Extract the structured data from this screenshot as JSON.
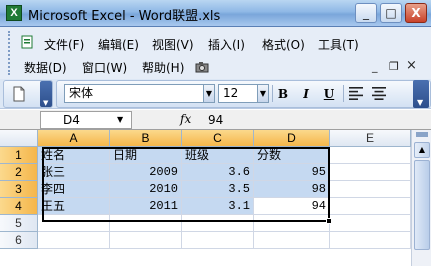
{
  "window": {
    "title": "Microsoft Excel - Word联盟.xls",
    "app_icon": "excel-icon",
    "controls": {
      "minimize": "_",
      "maximize": "□",
      "close": "X"
    }
  },
  "menu": {
    "items": [
      {
        "label": "文件(F)"
      },
      {
        "label": "编辑(E)"
      },
      {
        "label": "视图(V)"
      },
      {
        "label": "插入(I)"
      },
      {
        "label": "格式(O)"
      },
      {
        "label": "工具(T)"
      },
      {
        "label": "数据(D)"
      },
      {
        "label": "窗口(W)"
      },
      {
        "label": "帮助(H)"
      }
    ],
    "doc_controls": {
      "minimize": "_",
      "restore": "❐",
      "close": "×"
    }
  },
  "toolbar": {
    "font_name": "宋体",
    "font_size": "12",
    "bold": "B",
    "italic": "I",
    "underline": "U"
  },
  "formula_bar": {
    "name_box": "D4",
    "fx": "fx",
    "value": "94"
  },
  "sheet": {
    "columns": [
      "A",
      "B",
      "C",
      "D",
      "E"
    ],
    "rows": [
      "1",
      "2",
      "3",
      "4",
      "5",
      "6"
    ],
    "selected_columns": [
      "A",
      "B",
      "C",
      "D"
    ],
    "selected_rows": [
      "1",
      "2",
      "3",
      "4"
    ],
    "active_cell": "D4",
    "cells": [
      [
        "姓名",
        "日期",
        "班级",
        "分数"
      ],
      [
        "张三",
        "2009",
        "3.6",
        "95"
      ],
      [
        "李四",
        "2010",
        "3.5",
        "98"
      ],
      [
        "王五",
        "2011",
        "3.1",
        "94"
      ]
    ]
  },
  "colors": {
    "selection_fill": "#c5d9f1",
    "selected_header": "#f5b64a",
    "title_bar": "#8fb8e6"
  }
}
